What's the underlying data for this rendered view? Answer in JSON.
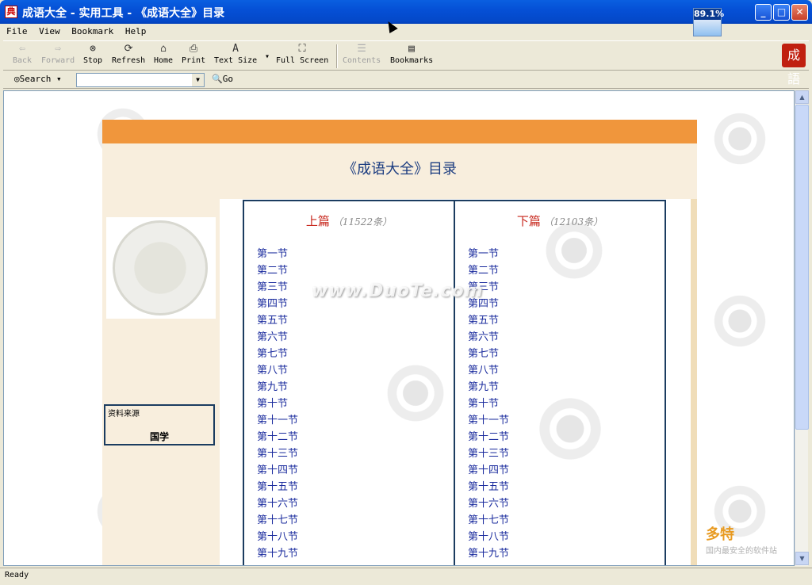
{
  "window": {
    "title": "成语大全 - 实用工具 - 《成语大全》目录",
    "app_icon": "典",
    "zoom": "89.1%"
  },
  "menu": [
    "File",
    "View",
    "Bookmark",
    "Help"
  ],
  "toolbar": {
    "back": "Back",
    "forward": "Forward",
    "stop": "Stop",
    "refresh": "Refresh",
    "home": "Home",
    "print": "Print",
    "text_size": "Text Size",
    "full_screen": "Full Screen",
    "contents": "Contents",
    "bookmarks": "Bookmarks",
    "logo": "成語"
  },
  "searchbar": {
    "search": "Search",
    "query": "",
    "go": "Go"
  },
  "page": {
    "title": "《成语大全》目录",
    "source_label": "资料来源",
    "source_value": "国学",
    "watermark": "www.DuoTe.com",
    "left_column": {
      "heading": "上篇",
      "count": "（11522条）",
      "sections": [
        "第一节",
        "第二节",
        "第三节",
        "第四节",
        "第五节",
        "第六节",
        "第七节",
        "第八节",
        "第九节",
        "第十节",
        "第十一节",
        "第十二节",
        "第十三节",
        "第十四节",
        "第十五节",
        "第十六节",
        "第十七节",
        "第十八节",
        "第十九节"
      ]
    },
    "right_column": {
      "heading": "下篇",
      "count": "（12103条）",
      "sections": [
        "第一节",
        "第二节",
        "第三节",
        "第四节",
        "第五节",
        "第六节",
        "第七节",
        "第八节",
        "第九节",
        "第十节",
        "第十一节",
        "第十二节",
        "第十三节",
        "第十四节",
        "第十五节",
        "第十六节",
        "第十七节",
        "第十八节",
        "第十九节"
      ]
    }
  },
  "status": {
    "text": "Ready",
    "corner_logo": "多特",
    "corner_caption": "国内最安全的软件站"
  }
}
